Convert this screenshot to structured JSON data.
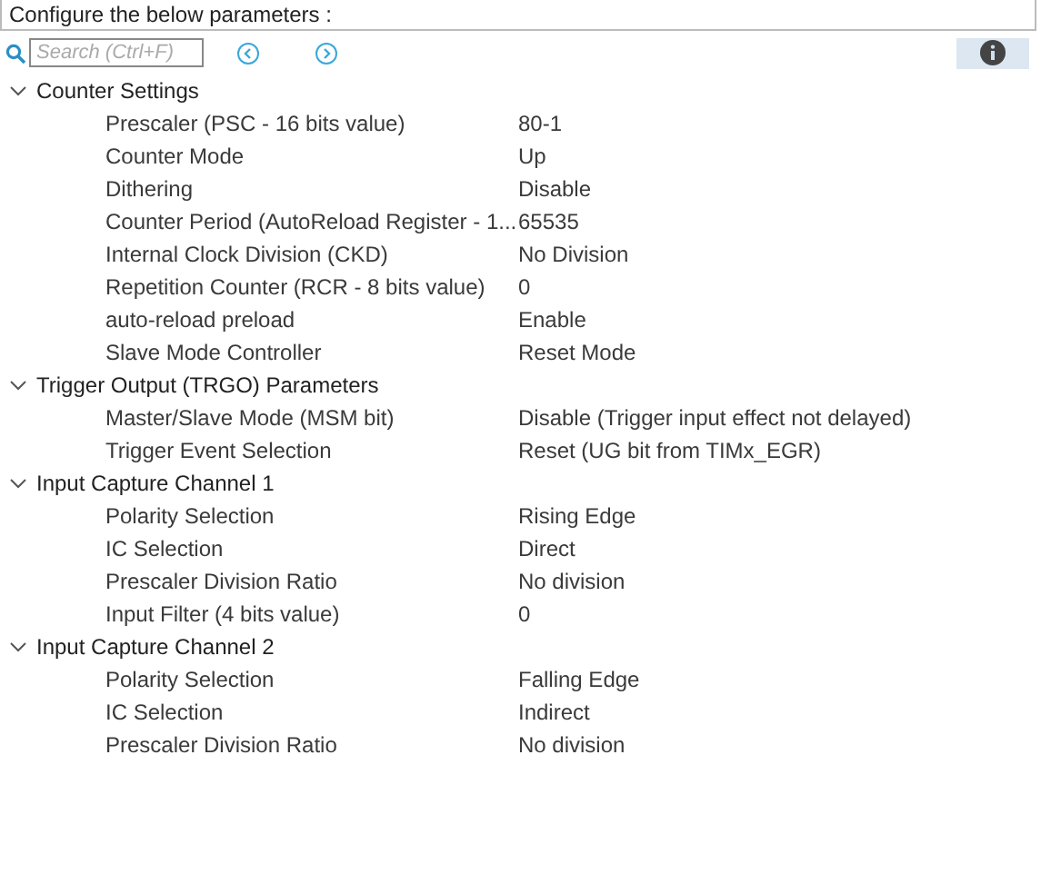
{
  "header": {
    "text": "Configure the below parameters :"
  },
  "search": {
    "placeholder": "Search (Ctrl+F)"
  },
  "groups": [
    {
      "label": "Counter Settings",
      "expanded": true,
      "children": [
        {
          "label": "Prescaler (PSC - 16 bits value)",
          "value": "80-1"
        },
        {
          "label": "Counter Mode",
          "value": "Up"
        },
        {
          "label": "Dithering",
          "value": "Disable"
        },
        {
          "label": "Counter Period (AutoReload Register - 1...",
          "value": "65535"
        },
        {
          "label": "Internal Clock Division (CKD)",
          "value": "No Division"
        },
        {
          "label": "Repetition Counter (RCR - 8 bits value)",
          "value": "0"
        },
        {
          "label": "auto-reload preload",
          "value": "Enable"
        },
        {
          "label": "Slave Mode Controller",
          "value": "Reset Mode"
        }
      ]
    },
    {
      "label": "Trigger Output (TRGO) Parameters",
      "expanded": true,
      "children": [
        {
          "label": "Master/Slave Mode (MSM bit)",
          "value": "Disable (Trigger input effect not delayed)"
        },
        {
          "label": "Trigger Event Selection",
          "value": "Reset (UG bit from TIMx_EGR)"
        }
      ]
    },
    {
      "label": "Input Capture Channel 1",
      "expanded": true,
      "children": [
        {
          "label": "Polarity Selection",
          "value": "Rising Edge"
        },
        {
          "label": "IC Selection",
          "value": "Direct"
        },
        {
          "label": "Prescaler Division Ratio",
          "value": "No division"
        },
        {
          "label": "Input Filter (4 bits value)",
          "value": "0"
        }
      ]
    },
    {
      "label": "Input Capture Channel 2",
      "expanded": true,
      "children": [
        {
          "label": "Polarity Selection",
          "value": "Falling Edge"
        },
        {
          "label": "IC Selection",
          "value": "Indirect"
        },
        {
          "label": "Prescaler Division Ratio",
          "value": "No division"
        }
      ]
    }
  ]
}
